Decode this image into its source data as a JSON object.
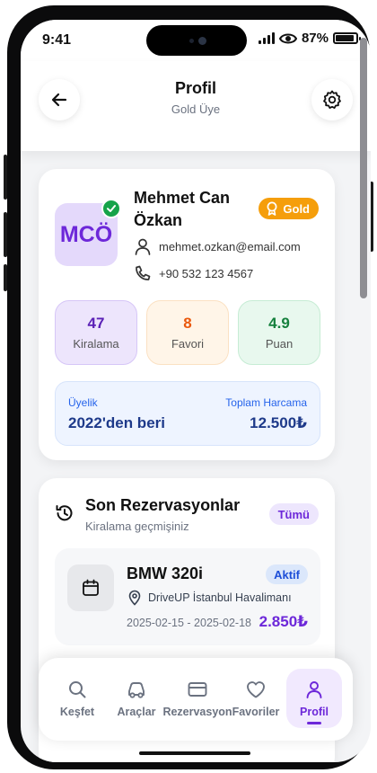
{
  "status_bar": {
    "time": "9:41",
    "battery": "87%"
  },
  "header": {
    "title": "Profil",
    "subtitle": "Gold Üye"
  },
  "profile": {
    "initials": "MCÖ",
    "name": "Mehmet Can Özkan",
    "badge": "Gold",
    "email": "mehmet.ozkan@email.com",
    "phone": "+90 532 123 4567"
  },
  "stats": [
    {
      "value": "47",
      "label": "Kiralama",
      "color": "#5b21b6"
    },
    {
      "value": "8",
      "label": "Favori",
      "color": "#ea580c"
    },
    {
      "value": "4.9",
      "label": "Puan",
      "color": "#15803d"
    }
  ],
  "membership": {
    "label": "Üyelik",
    "value": "2022'den beri",
    "spend_label": "Toplam Harcama",
    "spend_value": "12.500₺"
  },
  "reservations": {
    "title": "Son Rezervasyonlar",
    "subtitle": "Kiralama geçmişiniz",
    "all_label": "Tümü",
    "items": [
      {
        "car": "BMW 320i",
        "status": "Aktif",
        "location": "DriveUP İstanbul Havalimanı",
        "dates": "2025-02-15 - 2025-02-18",
        "price": "2.850₺"
      }
    ]
  },
  "tabbar": {
    "items": [
      {
        "label": "Keşfet",
        "icon": "search-icon"
      },
      {
        "label": "Araçlar",
        "icon": "car-icon"
      },
      {
        "label": "Rezervasyon",
        "icon": "credit-card-icon"
      },
      {
        "label": "Favoriler",
        "icon": "heart-icon"
      },
      {
        "label": "Profil",
        "icon": "user-icon"
      }
    ],
    "active": "Profil"
  },
  "colors": {
    "accent": "#6d28d9",
    "gold": "#f59e0b",
    "blue": "#2563eb"
  }
}
